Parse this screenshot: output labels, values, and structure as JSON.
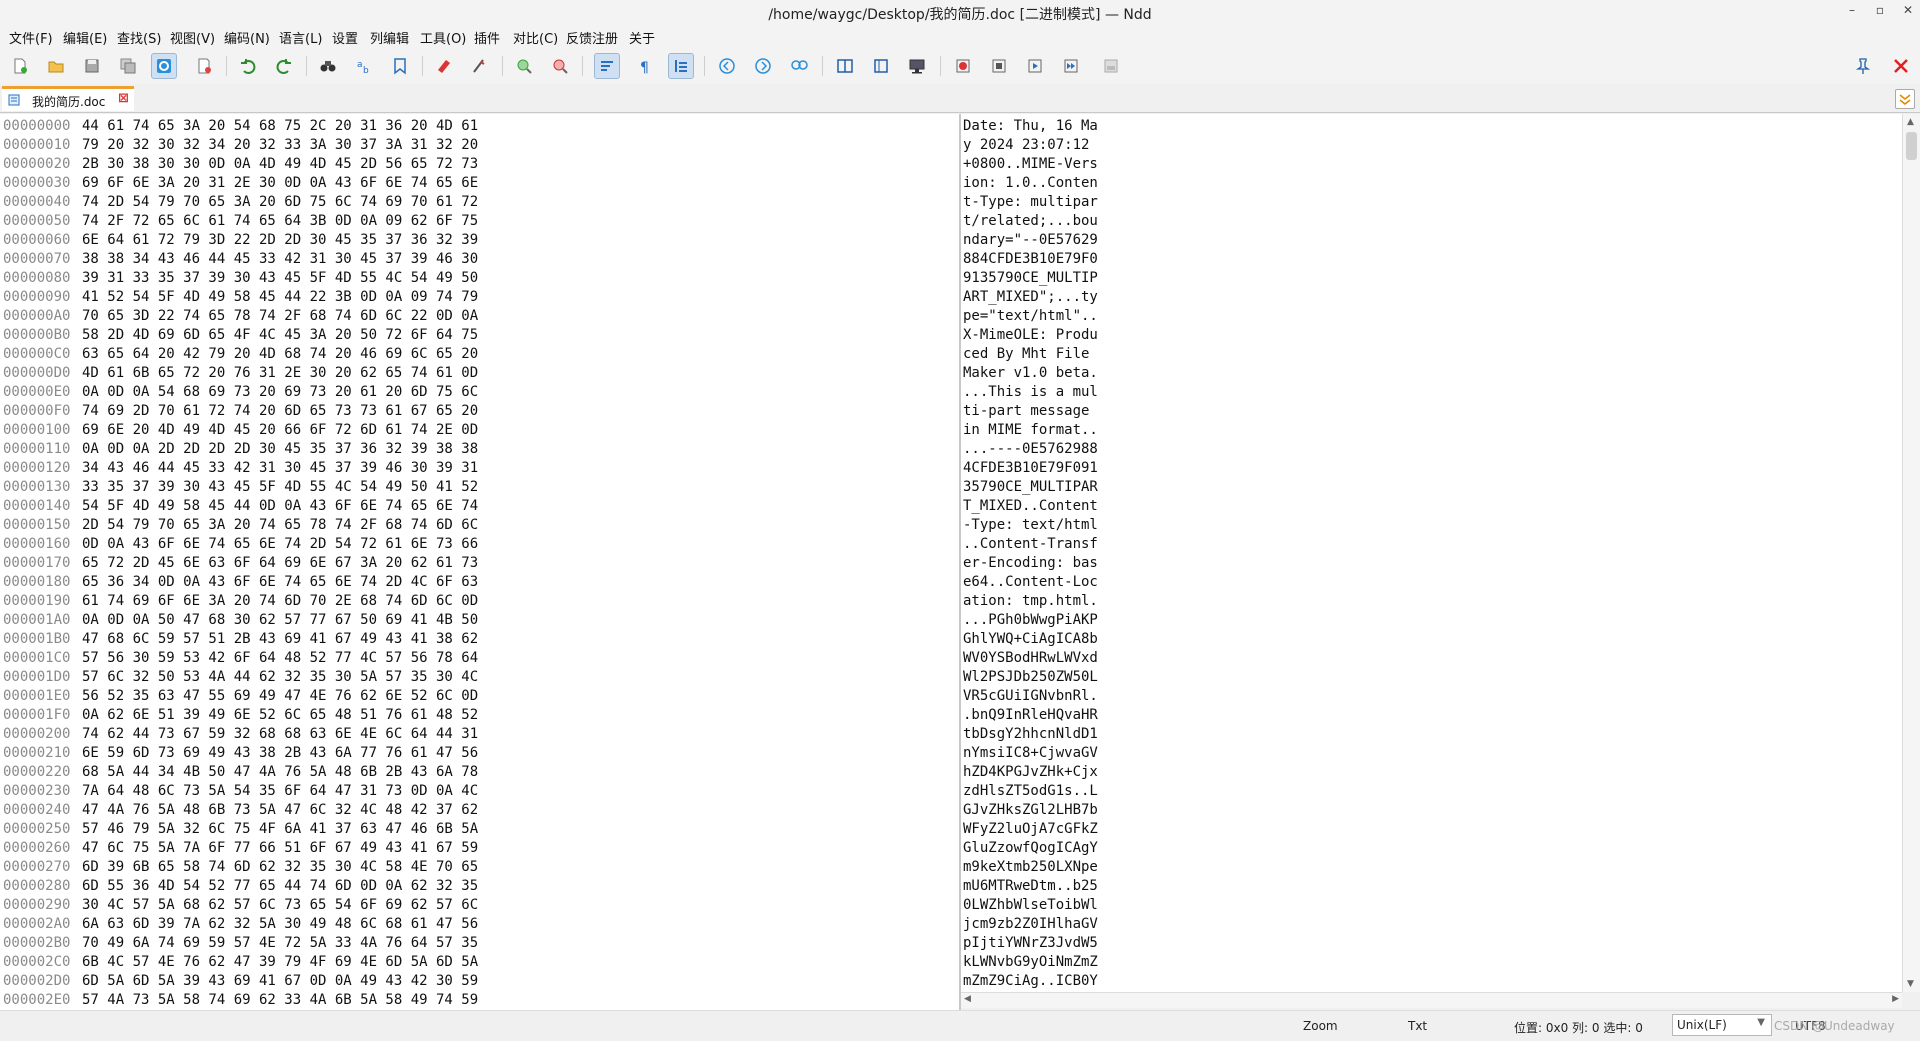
{
  "window": {
    "title": "/home/waygc/Desktop/我的简历.doc [二进制模式] — Ndd"
  },
  "menu": [
    "文件(F)",
    "编辑(E)",
    "查找(S)",
    "视图(V)",
    "编码(N)",
    "语言(L)",
    "设置",
    "列编辑",
    "工具(O)",
    "插件",
    "对比(C)",
    "反馈注册",
    "关于"
  ],
  "tab": {
    "label": "我的简历.doc"
  },
  "rows": [
    {
      "addr": "00000000",
      "hex": "44 61 74 65 3A 20 54 68 75 2C 20 31 36 20 4D 61",
      "text": "Date: Thu, 16 Ma"
    },
    {
      "addr": "00000010",
      "hex": "79 20 32 30 32 34 20 32 33 3A 30 37 3A 31 32 20",
      "text": "y 2024 23:07:12 "
    },
    {
      "addr": "00000020",
      "hex": "2B 30 38 30 30 0D 0A 4D 49 4D 45 2D 56 65 72 73",
      "text": "+0800..MIME-Vers"
    },
    {
      "addr": "00000030",
      "hex": "69 6F 6E 3A 20 31 2E 30 0D 0A 43 6F 6E 74 65 6E",
      "text": "ion: 1.0..Conten"
    },
    {
      "addr": "00000040",
      "hex": "74 2D 54 79 70 65 3A 20 6D 75 6C 74 69 70 61 72",
      "text": "t-Type: multipar"
    },
    {
      "addr": "00000050",
      "hex": "74 2F 72 65 6C 61 74 65 64 3B 0D 0A 09 62 6F 75",
      "text": "t/related;...bou"
    },
    {
      "addr": "00000060",
      "hex": "6E 64 61 72 79 3D 22 2D 2D 30 45 35 37 36 32 39",
      "text": "ndary=\"--0E57629"
    },
    {
      "addr": "00000070",
      "hex": "38 38 34 43 46 44 45 33 42 31 30 45 37 39 46 30",
      "text": "884CFDE3B10E79F0"
    },
    {
      "addr": "00000080",
      "hex": "39 31 33 35 37 39 30 43 45 5F 4D 55 4C 54 49 50",
      "text": "9135790CE_MULTIP"
    },
    {
      "addr": "00000090",
      "hex": "41 52 54 5F 4D 49 58 45 44 22 3B 0D 0A 09 74 79",
      "text": "ART_MIXED\";...ty"
    },
    {
      "addr": "000000A0",
      "hex": "70 65 3D 22 74 65 78 74 2F 68 74 6D 6C 22 0D 0A",
      "text": "pe=\"text/html\".."
    },
    {
      "addr": "000000B0",
      "hex": "58 2D 4D 69 6D 65 4F 4C 45 3A 20 50 72 6F 64 75",
      "text": "X-MimeOLE: Produ"
    },
    {
      "addr": "000000C0",
      "hex": "63 65 64 20 42 79 20 4D 68 74 20 46 69 6C 65 20",
      "text": "ced By Mht File "
    },
    {
      "addr": "000000D0",
      "hex": "4D 61 6B 65 72 20 76 31 2E 30 20 62 65 74 61 0D",
      "text": "Maker v1.0 beta."
    },
    {
      "addr": "000000E0",
      "hex": "0A 0D 0A 54 68 69 73 20 69 73 20 61 20 6D 75 6C",
      "text": "...This is a mul"
    },
    {
      "addr": "000000F0",
      "hex": "74 69 2D 70 61 72 74 20 6D 65 73 73 61 67 65 20",
      "text": "ti-part message "
    },
    {
      "addr": "00000100",
      "hex": "69 6E 20 4D 49 4D 45 20 66 6F 72 6D 61 74 2E 0D",
      "text": "in MIME format.."
    },
    {
      "addr": "00000110",
      "hex": "0A 0D 0A 2D 2D 2D 2D 30 45 35 37 36 32 39 38 38",
      "text": "...----0E5762988"
    },
    {
      "addr": "00000120",
      "hex": "34 43 46 44 45 33 42 31 30 45 37 39 46 30 39 31",
      "text": "4CFDE3B10E79F091"
    },
    {
      "addr": "00000130",
      "hex": "33 35 37 39 30 43 45 5F 4D 55 4C 54 49 50 41 52",
      "text": "35790CE_MULTIPAR"
    },
    {
      "addr": "00000140",
      "hex": "54 5F 4D 49 58 45 44 0D 0A 43 6F 6E 74 65 6E 74",
      "text": "T_MIXED..Content"
    },
    {
      "addr": "00000150",
      "hex": "2D 54 79 70 65 3A 20 74 65 78 74 2F 68 74 6D 6C",
      "text": "-Type: text/html"
    },
    {
      "addr": "00000160",
      "hex": "0D 0A 43 6F 6E 74 65 6E 74 2D 54 72 61 6E 73 66",
      "text": "..Content-Transf"
    },
    {
      "addr": "00000170",
      "hex": "65 72 2D 45 6E 63 6F 64 69 6E 67 3A 20 62 61 73",
      "text": "er-Encoding: bas"
    },
    {
      "addr": "00000180",
      "hex": "65 36 34 0D 0A 43 6F 6E 74 65 6E 74 2D 4C 6F 63",
      "text": "e64..Content-Loc"
    },
    {
      "addr": "00000190",
      "hex": "61 74 69 6F 6E 3A 20 74 6D 70 2E 68 74 6D 6C 0D",
      "text": "ation: tmp.html."
    },
    {
      "addr": "000001A0",
      "hex": "0A 0D 0A 50 47 68 30 62 57 77 67 50 69 41 4B 50",
      "text": "...PGh0bWwgPiAKP"
    },
    {
      "addr": "000001B0",
      "hex": "47 68 6C 59 57 51 2B 43 69 41 67 49 43 41 38 62",
      "text": "GhlYWQ+CiAgICA8b"
    },
    {
      "addr": "000001C0",
      "hex": "57 56 30 59 53 42 6F 64 48 52 77 4C 57 56 78 64",
      "text": "WV0YSBodHRwLWVxd"
    },
    {
      "addr": "000001D0",
      "hex": "57 6C 32 50 53 4A 44 62 32 35 30 5A 57 35 30 4C",
      "text": "Wl2PSJDb250ZW50L"
    },
    {
      "addr": "000001E0",
      "hex": "56 52 35 63 47 55 69 49 47 4E 76 62 6E 52 6C 0D",
      "text": "VR5cGUiIGNvbnRl."
    },
    {
      "addr": "000001F0",
      "hex": "0A 62 6E 51 39 49 6E 52 6C 65 48 51 76 61 48 52",
      "text": ".bnQ9InRleHQvaHR"
    },
    {
      "addr": "00000200",
      "hex": "74 62 44 73 67 59 32 68 68 63 6E 4E 6C 64 44 31",
      "text": "tbDsgY2hhcnNldD1"
    },
    {
      "addr": "00000210",
      "hex": "6E 59 6D 73 69 49 43 38 2B 43 6A 77 76 61 47 56",
      "text": "nYmsiIC8+CjwvaGV"
    },
    {
      "addr": "00000220",
      "hex": "68 5A 44 34 4B 50 47 4A 76 5A 48 6B 2B 43 6A 78",
      "text": "hZD4KPGJvZHk+Cjx"
    },
    {
      "addr": "00000230",
      "hex": "7A 64 48 6C 73 5A 54 35 6F 64 47 31 73 0D 0A 4C",
      "text": "zdHlsZT5odG1s..L"
    },
    {
      "addr": "00000240",
      "hex": "47 4A 76 5A 48 6B 73 5A 47 6C 32 4C 48 42 37 62",
      "text": "GJvZHksZGl2LHB7b"
    },
    {
      "addr": "00000250",
      "hex": "57 46 79 5A 32 6C 75 4F 6A 41 37 63 47 46 6B 5A",
      "text": "WFyZ2luOjA7cGFkZ"
    },
    {
      "addr": "00000260",
      "hex": "47 6C 75 5A 7A 6F 77 66 51 6F 67 49 43 41 67 59",
      "text": "GluZzowfQogICAgY"
    },
    {
      "addr": "00000270",
      "hex": "6D 39 6B 65 58 74 6D 62 32 35 30 4C 58 4E 70 65",
      "text": "m9keXtmb250LXNpe"
    },
    {
      "addr": "00000280",
      "hex": "6D 55 36 4D 54 52 77 65 44 74 6D 0D 0A 62 32 35",
      "text": "mU6MTRweDtm..b25"
    },
    {
      "addr": "00000290",
      "hex": "30 4C 57 5A 68 62 57 6C 73 65 54 6F 69 62 57 6C",
      "text": "0LWZhbWlseToibWl"
    },
    {
      "addr": "000002A0",
      "hex": "6A 63 6D 39 7A 62 32 5A 30 49 48 6C 68 61 47 56",
      "text": "jcm9zb2Z0IHlhaGV"
    },
    {
      "addr": "000002B0",
      "hex": "70 49 6A 74 69 59 57 4E 72 5A 33 4A 76 64 57 35",
      "text": "pIjtiYWNrZ3JvdW5"
    },
    {
      "addr": "000002C0",
      "hex": "6B 4C 57 4E 76 62 47 39 79 4F 69 4E 6D 5A 6D 5A",
      "text": "kLWNvbG9yOiNmZmZ"
    },
    {
      "addr": "000002D0",
      "hex": "6D 5A 6D 5A 39 43 69 41 67 0D 0A 49 43 42 30 59",
      "text": "mZmZ9CiAg..ICB0Y"
    },
    {
      "addr": "000002E0",
      "hex": "57 4A 73 5A 58 74 69 62 33 4A 6B 5A 58 49 74 59",
      "text": "WJsZXtib3JkZXItY"
    }
  ],
  "status": {
    "zoom_label": "Zoom",
    "txt_label": "Txt",
    "position": "位置: 0x0 列: 0 选中: 0",
    "eol": "Unix(LF)",
    "encoding": "UTF8",
    "watermark": "CSDN @Undeadway"
  }
}
